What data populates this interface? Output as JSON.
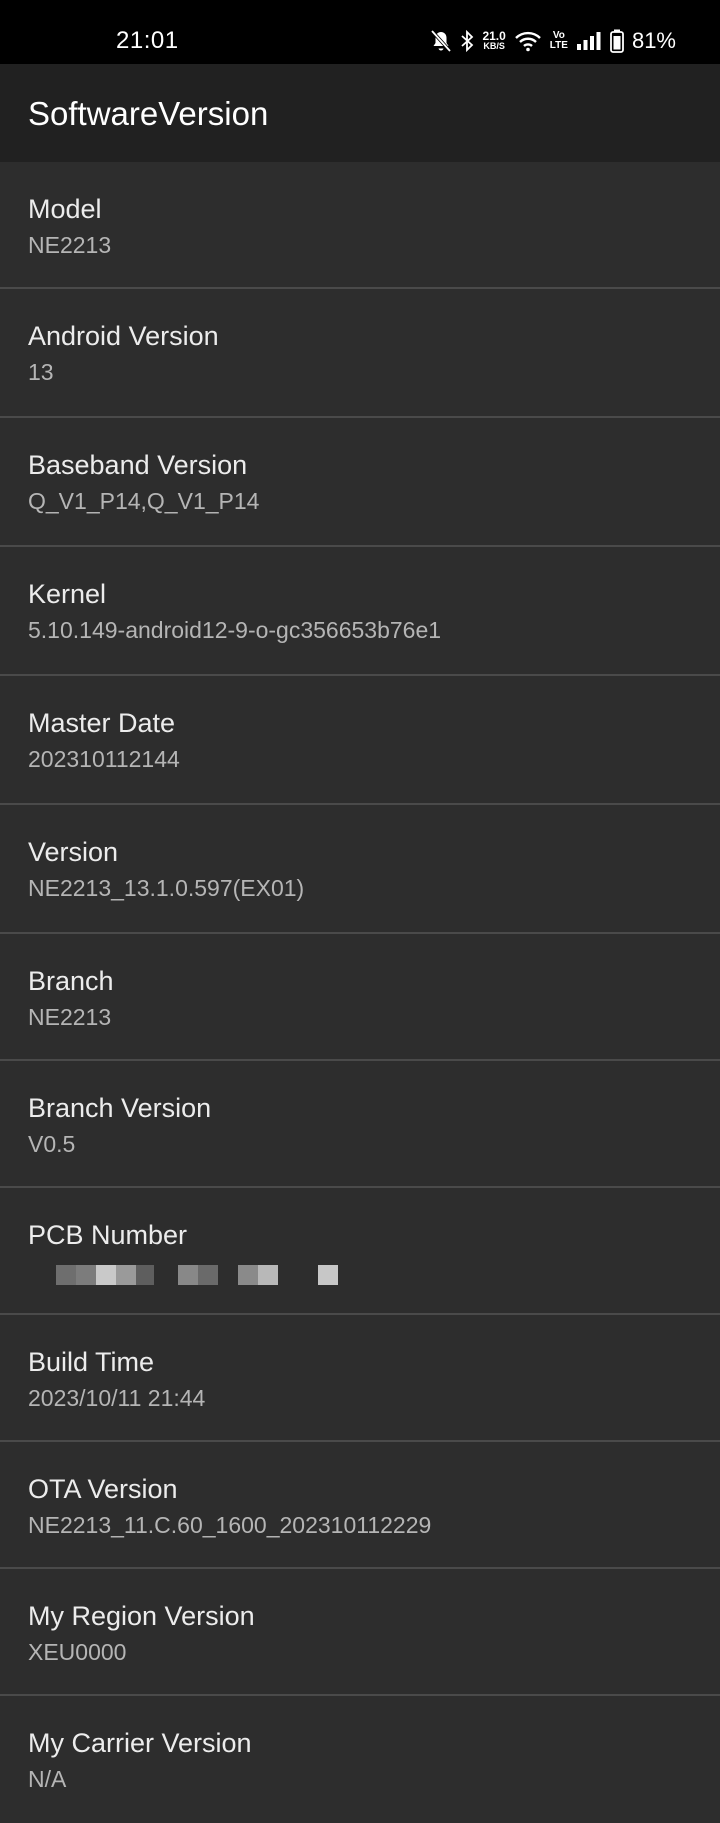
{
  "status_bar": {
    "time": "21:01",
    "net_speed_value": "21.0",
    "net_speed_unit": "KB/S",
    "volte_top": "Vo",
    "volte_bottom": "LTE",
    "battery_percent": "81%",
    "icons": [
      "bell-muted-icon",
      "bluetooth-icon",
      "wifi-icon",
      "signal-icon",
      "battery-icon"
    ]
  },
  "app_bar": {
    "title": "SoftwareVersion"
  },
  "items": [
    {
      "label": "Model",
      "value": "NE2213"
    },
    {
      "label": "Android Version",
      "value": "13"
    },
    {
      "label": "Baseband Version",
      "value": "Q_V1_P14,Q_V1_P14"
    },
    {
      "label": "Kernel",
      "value": "5.10.149-android12-9-o-gc356653b76e1"
    },
    {
      "label": "Master Date",
      "value": "202310112144"
    },
    {
      "label": "Version",
      "value": "NE2213_13.1.0.597(EX01)"
    },
    {
      "label": "Branch",
      "value": "NE2213"
    },
    {
      "label": "Branch Version",
      "value": "V0.5"
    },
    {
      "label": "PCB Number",
      "value": ""
    },
    {
      "label": "Build Time",
      "value": "2023/10/11 21:44"
    },
    {
      "label": "OTA Version",
      "value": "NE2213_11.C.60_1600_202310112229"
    },
    {
      "label": "My Region Version",
      "value": "XEU0000"
    },
    {
      "label": "My Carrier Version",
      "value": "N/A"
    }
  ]
}
